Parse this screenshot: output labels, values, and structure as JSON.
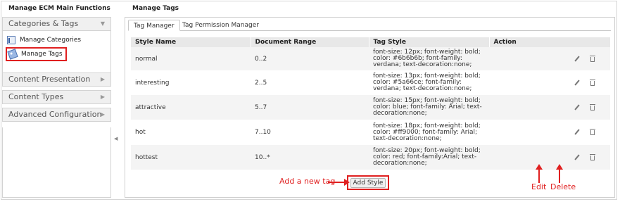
{
  "left": {
    "title": "Manage ECM Main Functions",
    "sections": [
      {
        "label": "Categories & Tags",
        "icon": "chevron-down-icon"
      },
      {
        "label": "Content Presentation",
        "icon": "chevron-right-icon"
      },
      {
        "label": "Content Types",
        "icon": "chevron-right-icon"
      },
      {
        "label": "Advanced Configuration",
        "icon": "chevron-right-icon"
      }
    ],
    "items": [
      {
        "label": "Manage Categories",
        "icon": "document-icon"
      },
      {
        "label": "Manage Tags",
        "icon": "tag-icon"
      }
    ]
  },
  "main": {
    "title": "Manage Tags",
    "tabs": [
      {
        "label": "Tag Manager"
      },
      {
        "label": "Tag Permission Manager"
      }
    ],
    "table": {
      "headers": [
        "Style Name",
        "Document Range",
        "Tag Style",
        "Action"
      ],
      "rows": [
        {
          "name": "normal",
          "range": "0..2",
          "style": "font-size: 12px; font-weight: bold; color: #6b6b6b; font-family: verdana; text-decoration:none;"
        },
        {
          "name": "interesting",
          "range": "2..5",
          "style": "font-size: 13px; font-weight: bold; color: #5a66ce; font-family: verdana; text-decoration:none;"
        },
        {
          "name": "attractive",
          "range": "5..7",
          "style": "font-size: 15px; font-weight: bold; color: blue; font-family: Arial; text-decoration:none;"
        },
        {
          "name": "hot",
          "range": "7..10",
          "style": "font-size: 18px; font-weight: bold; color: #ff9000; font-family: Arial; text-decoration:none;"
        },
        {
          "name": "hottest",
          "range": "10..*",
          "style": "font-size: 20px; font-weight: bold; color: red; font-family:Arial; text-decoration:none;"
        }
      ]
    },
    "add_style_label": "Add Style"
  },
  "annotations": {
    "add_tag": "Add a new tag",
    "edit": "Edit",
    "delete": "Delete",
    "color": "#e02020"
  }
}
